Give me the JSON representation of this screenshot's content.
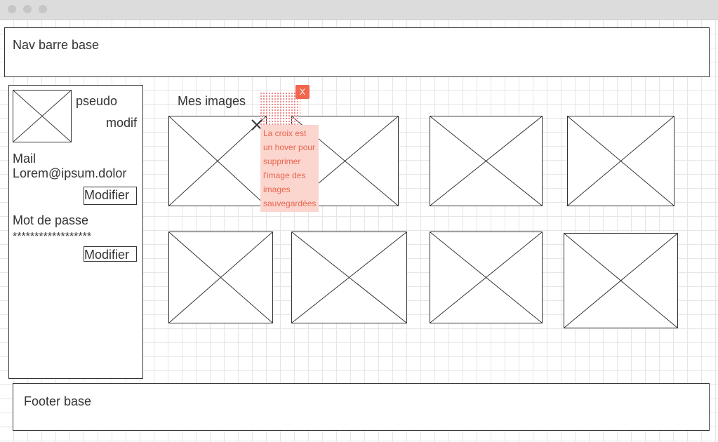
{
  "nav": {
    "title": "Nav barre base"
  },
  "sidebar": {
    "pseudo": "pseudo",
    "modif": "modif",
    "mail_label": "Mail",
    "mail_value": "Lorem@ipsum.dolor",
    "mail_button": "Modifier",
    "password_label": "Mot de passe",
    "password_value": "******************",
    "password_button": "Modifier"
  },
  "main": {
    "title": "Mes images",
    "images": [
      {
        "icon": "image-placeholder"
      },
      {
        "icon": "image-placeholder"
      },
      {
        "icon": "image-placeholder"
      },
      {
        "icon": "image-placeholder"
      },
      {
        "icon": "image-placeholder"
      },
      {
        "icon": "image-placeholder"
      },
      {
        "icon": "image-placeholder"
      },
      {
        "icon": "image-placeholder"
      }
    ]
  },
  "annotation": {
    "close": "X",
    "lines": [
      "La croix est",
      "un hover pour",
      "supprimer",
      "l'image des",
      "images",
      "sauvegardées"
    ]
  },
  "footer": {
    "title": "Footer base"
  },
  "colors": {
    "note_bg": "#fbd6cf",
    "note_text": "#e8654f",
    "note_close": "#f2654f"
  }
}
